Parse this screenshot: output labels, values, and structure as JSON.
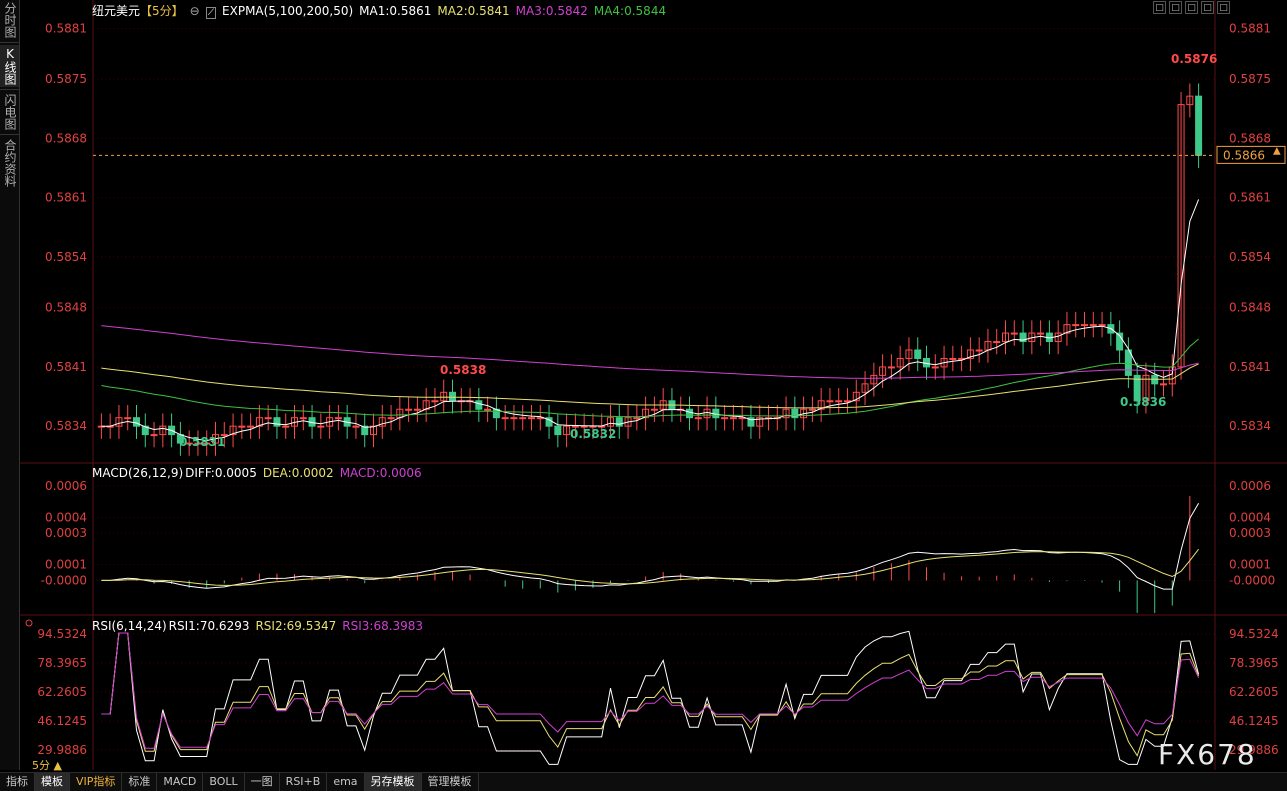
{
  "sidebar": {
    "tabs": [
      {
        "label": "分时图",
        "active": false
      },
      {
        "label": "K线图",
        "active": true
      },
      {
        "label": "闪电图",
        "active": false
      },
      {
        "label": "合约资料",
        "active": false
      }
    ]
  },
  "header": {
    "symbol": "纽元美元",
    "period": "【5分】",
    "indicator": "EXPMA(5,100,200,50)",
    "ma1": "MA1:0.5861",
    "ma2": "MA2:0.5841",
    "ma3": "MA3:0.5842",
    "ma4": "MA4:0.5844",
    "window_controls": [
      "□",
      "□",
      "□",
      "□",
      "□"
    ]
  },
  "colors": {
    "up": "#ff4a4a",
    "down": "#3ec98a",
    "ma1": "#ffffff",
    "ma2": "#e8e070",
    "ma3": "#d040d0",
    "ma4": "#40c040",
    "axis": "#e04040",
    "current": "#f0a040",
    "grid": "#3a0000"
  },
  "main_axis": {
    "ticks": [
      "0.5881",
      "0.5875",
      "0.5868",
      "0.5861",
      "0.5854",
      "0.5848",
      "0.5841",
      "0.5834"
    ],
    "current_price": "0.5866",
    "annotations": {
      "high": "0.5876",
      "mid_high": "0.5838",
      "low1": "0.5831",
      "low2": "0.5832",
      "low3": "0.5836"
    }
  },
  "macd": {
    "title": "MACD(26,12,9)",
    "diff": "DIFF:0.0005",
    "dea": "DEA:0.0002",
    "macd": "MACD:0.0006",
    "ticks": [
      "0.0006",
      "0.0004",
      "0.0003",
      "0.0001",
      "-0.0000"
    ]
  },
  "rsi": {
    "title": "RSI(6,14,24)",
    "rsi1": "RSI1:70.6293",
    "rsi2": "RSI2:69.5347",
    "rsi3": "RSI3:68.3983",
    "ticks": [
      "94.5324",
      "78.3965",
      "62.2605",
      "46.1245",
      "29.9886"
    ]
  },
  "bottom_tabs": [
    {
      "label": "指标",
      "active": false
    },
    {
      "label": "模板",
      "active": true
    },
    {
      "label": "VIP指标",
      "active": false,
      "vip": true
    },
    {
      "label": "标准",
      "active": false
    },
    {
      "label": "MACD",
      "active": false
    },
    {
      "label": "BOLL",
      "active": false
    },
    {
      "label": "一图",
      "active": false
    },
    {
      "label": "RSI+B",
      "active": false
    },
    {
      "label": "ema",
      "active": false
    },
    {
      "label": "另存模板",
      "active": true
    },
    {
      "label": "管理模板",
      "active": false
    }
  ],
  "period_selector": "5分 ▲",
  "watermark": "FX678",
  "chart_data": {
    "type": "candlestick",
    "series_open": [
      0.5834,
      0.5834,
      0.5834,
      0.5835,
      0.5835,
      0.5834,
      0.5833,
      0.5833,
      0.5834,
      0.5833,
      0.5832,
      0.5832,
      0.5832,
      0.5832,
      0.5833,
      0.5833,
      0.5834,
      0.5834,
      0.5834,
      0.5835,
      0.5835,
      0.5834,
      0.5834,
      0.5835,
      0.5835,
      0.5834,
      0.5834,
      0.5835,
      0.5835,
      0.5834,
      0.5834,
      0.5833,
      0.5834,
      0.5835,
      0.5835,
      0.5836,
      0.5836,
      0.5836,
      0.5837,
      0.5837,
      0.5838,
      0.5837,
      0.5837,
      0.5837,
      0.5836,
      0.5836,
      0.5835,
      0.5835,
      0.5835,
      0.5835,
      0.5835,
      0.5835,
      0.5834,
      0.5833,
      0.5834,
      0.5834,
      0.5834,
      0.5834,
      0.5834,
      0.5835,
      0.5834,
      0.5835,
      0.5835,
      0.5836,
      0.5836,
      0.5837,
      0.5836,
      0.5836,
      0.5835,
      0.5835,
      0.5836,
      0.5835,
      0.5835,
      0.5835,
      0.5835,
      0.5834,
      0.5835,
      0.5835,
      0.5835,
      0.5836,
      0.5835,
      0.5836,
      0.5836,
      0.5837,
      0.5837,
      0.5837,
      0.5837,
      0.5838,
      0.5839,
      0.584,
      0.5841,
      0.5841,
      0.5842,
      0.5843,
      0.5842,
      0.5841,
      0.5841,
      0.5842,
      0.5842,
      0.5842,
      0.5843,
      0.5843,
      0.5844,
      0.5844,
      0.5845,
      0.5845,
      0.5844,
      0.5845,
      0.5845,
      0.5844,
      0.5845,
      0.5846,
      0.5846,
      0.5846,
      0.5846,
      0.5846,
      0.5845,
      0.5843,
      0.584,
      0.5837,
      0.584,
      0.5839,
      0.5839,
      0.5841,
      0.5872,
      0.5873
    ],
    "series_close": [
      0.5834,
      0.5834,
      0.5835,
      0.5835,
      0.5834,
      0.5833,
      0.5833,
      0.5834,
      0.5833,
      0.5832,
      0.5832,
      0.5832,
      0.5832,
      0.5833,
      0.5833,
      0.5834,
      0.5834,
      0.5834,
      0.5835,
      0.5835,
      0.5834,
      0.5834,
      0.5835,
      0.5835,
      0.5834,
      0.5834,
      0.5835,
      0.5835,
      0.5834,
      0.5834,
      0.5833,
      0.5834,
      0.5835,
      0.5835,
      0.5836,
      0.5836,
      0.5836,
      0.5837,
      0.5837,
      0.5838,
      0.5837,
      0.5837,
      0.5837,
      0.5836,
      0.5836,
      0.5835,
      0.5835,
      0.5835,
      0.5835,
      0.5835,
      0.5835,
      0.5834,
      0.5833,
      0.5834,
      0.5834,
      0.5834,
      0.5834,
      0.5834,
      0.5835,
      0.5834,
      0.5835,
      0.5835,
      0.5836,
      0.5836,
      0.5837,
      0.5836,
      0.5836,
      0.5835,
      0.5835,
      0.5836,
      0.5835,
      0.5835,
      0.5835,
      0.5835,
      0.5834,
      0.5835,
      0.5835,
      0.5835,
      0.5836,
      0.5835,
      0.5836,
      0.5836,
      0.5837,
      0.5837,
      0.5837,
      0.5837,
      0.5838,
      0.5839,
      0.584,
      0.5841,
      0.5841,
      0.5842,
      0.5843,
      0.5842,
      0.5841,
      0.5841,
      0.5842,
      0.5842,
      0.5842,
      0.5843,
      0.5843,
      0.5844,
      0.5844,
      0.5845,
      0.5845,
      0.5844,
      0.5845,
      0.5845,
      0.5844,
      0.5845,
      0.5846,
      0.5846,
      0.5846,
      0.5846,
      0.5846,
      0.5845,
      0.5843,
      0.584,
      0.5837,
      0.584,
      0.5839,
      0.5839,
      0.5841,
      0.5872,
      0.5873,
      0.5866
    ],
    "y_range": [
      0.583,
      0.5882
    ],
    "macd_range": [
      -0.0002,
      0.0007
    ],
    "rsi_range": [
      20,
      100
    ]
  }
}
